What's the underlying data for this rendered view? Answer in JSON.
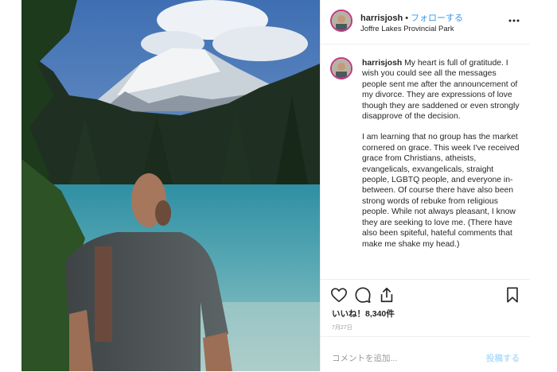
{
  "header": {
    "username": "harrisjosh",
    "separator": "•",
    "follow_label": "フォローする",
    "location": "Joffre Lakes Provincial Park",
    "more_icon": "more-options-icon"
  },
  "caption": {
    "username": "harrisjosh",
    "paragraph1": "My heart is full of gratitude. I wish you could see all the messages people sent me after the announcement of my divorce. They are expressions of love though they are saddened or even strongly disapprove of the decision.",
    "paragraph2": "I am learning that no group has the market cornered on grace. This week I've received grace from Christians, atheists, evangelicals, exvangelicals, straight people, LGBTQ people, and everyone in-between. Of course there have also been strong words of rebuke from religious people. While not always pleasant, I know they are seeking to love me. (There have also been spiteful, hateful comments that make me shake my head.)"
  },
  "actions": {
    "like_icon": "heart-icon",
    "comment_icon": "comment-icon",
    "share_icon": "share-icon",
    "save_icon": "bookmark-icon"
  },
  "likes": "いいね！8,340件",
  "date": "7月27日",
  "comment": {
    "placeholder": "コメントを追加...",
    "post_label": "投稿する"
  },
  "colors": {
    "link": "#3897f0",
    "post_disabled": "#b2dffc",
    "border": "#efefef",
    "lake": "#2f8fa3"
  }
}
